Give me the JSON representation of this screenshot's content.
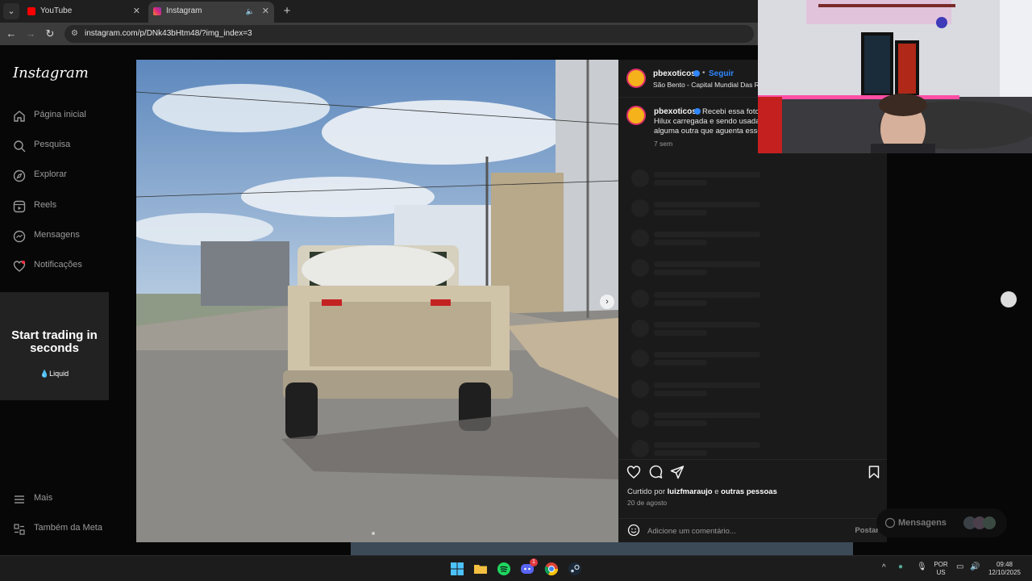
{
  "browser": {
    "tabs": [
      {
        "title": "YouTube",
        "active": false
      },
      {
        "title": "Instagram",
        "active": true
      }
    ],
    "url": "instagram.com/p/DNk43bHtm48/?img_index=3"
  },
  "sidebar": {
    "logo": "Instagram",
    "items": [
      {
        "label": "Página inicial",
        "icon": "home-icon"
      },
      {
        "label": "Pesquisa",
        "icon": "search-icon"
      },
      {
        "label": "Explorar",
        "icon": "compass-icon"
      },
      {
        "label": "Reels",
        "icon": "reels-icon"
      },
      {
        "label": "Mensagens",
        "icon": "messenger-icon"
      },
      {
        "label": "Notificações",
        "icon": "heart-icon"
      }
    ],
    "bottom": [
      {
        "label": "Mais",
        "icon": "menu-icon"
      },
      {
        "label": "Também da Meta",
        "icon": "meta-icon"
      }
    ]
  },
  "ad": {
    "headline": "Start trading in seconds",
    "brand": "Liquid"
  },
  "post": {
    "username": "pbexoticos",
    "follow": "Seguir",
    "location": "São Bento - Capital Mundial Das Redes",
    "caption_lines": [
      "Recebi essa foto",
      "Hilux carregada e sendo usada",
      "alguma outra que aguenta esse"
    ],
    "time": "7 sem",
    "liked_prefix": "Curtido por",
    "liked_user": "luizfmaraujo",
    "liked_and": "e",
    "liked_others": "outras pessoas",
    "date": "20 de agosto",
    "comment_placeholder": "Adicione um comentário...",
    "post_button": "Postar"
  },
  "messages_pill": {
    "label": "Mensagens"
  },
  "taskbar": {
    "lang": "POR",
    "region": "US",
    "time": "09:48",
    "date": "12/10/2025",
    "discord_badge": "1"
  },
  "colors": {
    "accent_blue": "#2f87ff",
    "bg_dark": "#070707",
    "panel": "#1a1a1a"
  }
}
